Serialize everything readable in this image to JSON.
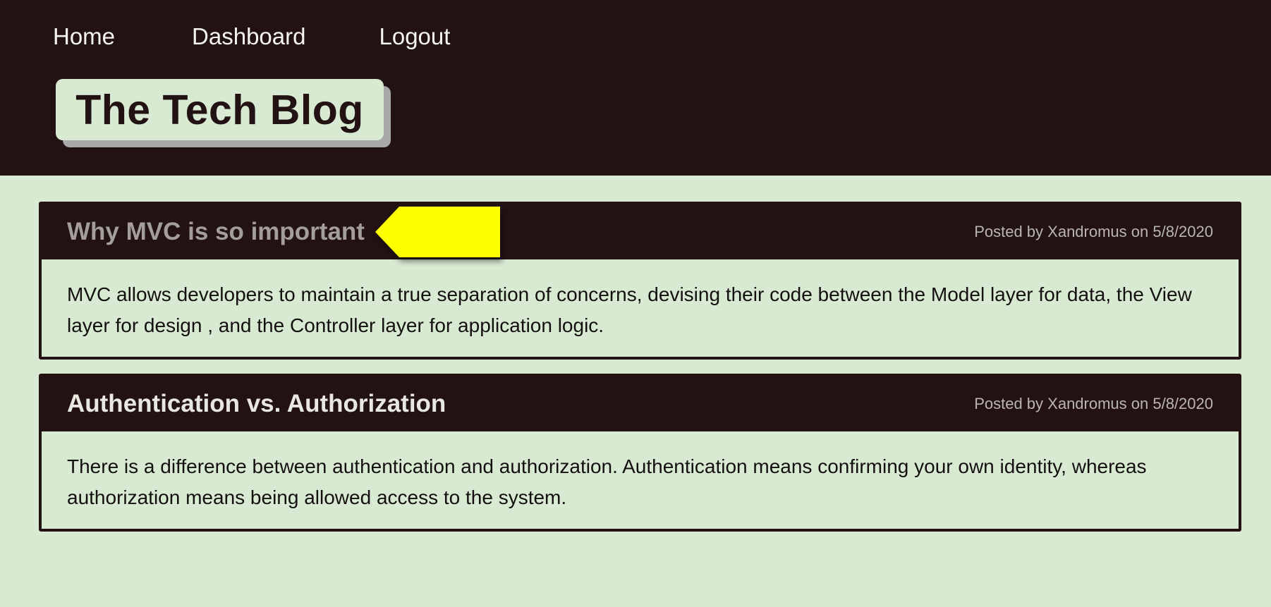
{
  "nav": {
    "home": "Home",
    "dashboard": "Dashboard",
    "logout": "Logout"
  },
  "site": {
    "title": "The Tech Blog"
  },
  "posts": [
    {
      "title": "Why MVC is so important",
      "meta": "Posted by Xandromus on 5/8/2020",
      "body": "MVC allows developers to maintain a true separation of concerns, devising their code between the Model layer for data, the View layer for design , and the Controller layer for application logic."
    },
    {
      "title": "Authentication vs. Authorization",
      "meta": "Posted by Xandromus on 5/8/2020",
      "body": "There is a difference between authentication and authorization. Authentication means confirming your own identity, whereas authorization means being allowed access to the system."
    }
  ],
  "annotation": {
    "icon": "pointer-arrow-icon",
    "color": "#ffff00"
  },
  "colors": {
    "header_bg": "#221213",
    "page_bg": "#d9ead3"
  }
}
